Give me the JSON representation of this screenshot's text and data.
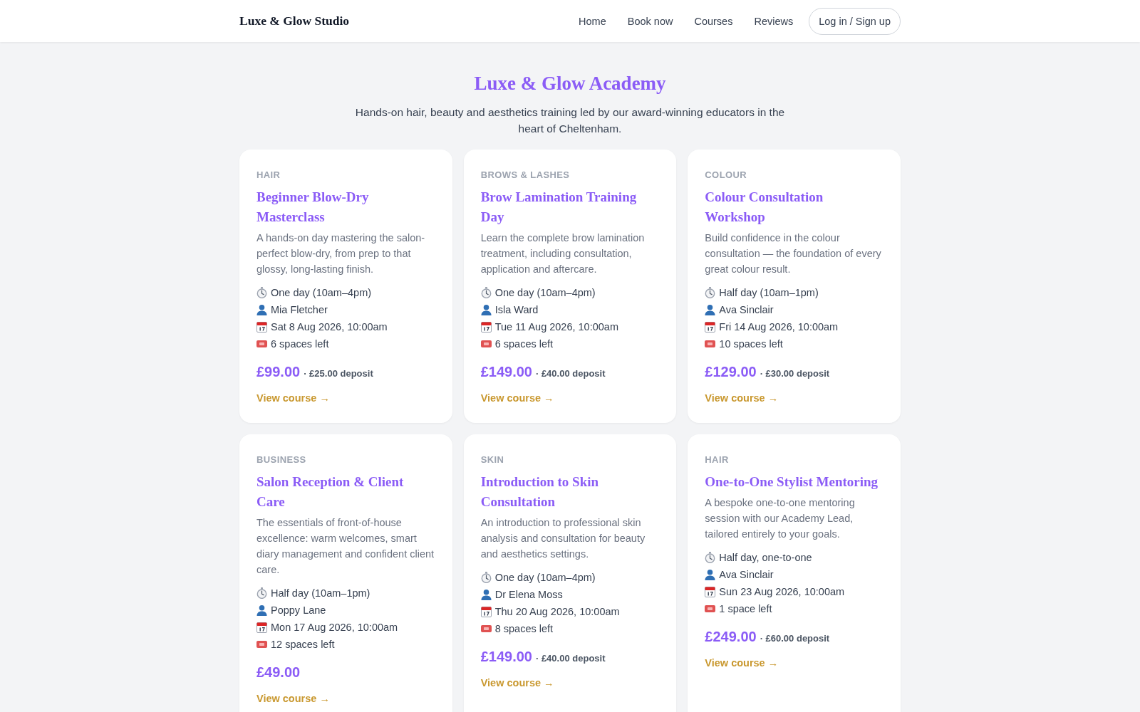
{
  "header": {
    "logo": "Luxe & Glow Studio",
    "nav": [
      "Home",
      "Book now",
      "Courses",
      "Reviews"
    ],
    "login_button": "Log in / Sign up"
  },
  "hero": {
    "title": "Luxe & Glow Academy",
    "subtitle": "Hands-on hair, beauty and aesthetics training led by our award-winning educators in the heart of Cheltenham."
  },
  "courses": [
    {
      "category": "HAIR",
      "title": "Beginner Blow-Dry Masterclass",
      "description": "A hands-on day mastering the salon-perfect blow-dry, from prep to that glossy, long-lasting finish.",
      "details": [
        {
          "kind": "duration",
          "text": "One day (10am–4pm)"
        },
        {
          "kind": "educator",
          "text": "Mia Fletcher"
        },
        {
          "kind": "date",
          "text": "Sat 8 Aug 2026, 10:00am"
        },
        {
          "kind": "spaces",
          "text": "6 spaces left"
        }
      ],
      "price": "£99.00",
      "deposit": "· £25.00 deposit",
      "link": "View course →"
    },
    {
      "category": "BROWS & LASHES",
      "title": "Brow Lamination Training Day",
      "description": "Learn the complete brow lamination treatment, including consultation, application and aftercare.",
      "details": [
        {
          "kind": "duration",
          "text": "One day (10am–4pm)"
        },
        {
          "kind": "educator",
          "text": "Isla Ward"
        },
        {
          "kind": "date",
          "text": "Tue 11 Aug 2026, 10:00am"
        },
        {
          "kind": "spaces",
          "text": "6 spaces left"
        }
      ],
      "price": "£149.00",
      "deposit": "· £40.00 deposit",
      "link": "View course →"
    },
    {
      "category": "COLOUR",
      "title": "Colour Consultation Workshop",
      "description": "Build confidence in the colour consultation — the foundation of every great colour result.",
      "details": [
        {
          "kind": "duration",
          "text": "Half day (10am–1pm)"
        },
        {
          "kind": "educator",
          "text": "Ava Sinclair"
        },
        {
          "kind": "date",
          "text": "Fri 14 Aug 2026, 10:00am"
        },
        {
          "kind": "spaces",
          "text": "10 spaces left"
        }
      ],
      "price": "£129.00",
      "deposit": "· £30.00 deposit",
      "link": "View course →"
    },
    {
      "category": "BUSINESS",
      "title": "Salon Reception & Client Care",
      "description": "The essentials of front-of-house excellence: warm welcomes, smart diary management and confident client care.",
      "details": [
        {
          "kind": "duration",
          "text": "Half day (10am–1pm)"
        },
        {
          "kind": "educator",
          "text": "Poppy Lane"
        },
        {
          "kind": "date",
          "text": "Mon 17 Aug 2026, 10:00am"
        },
        {
          "kind": "spaces",
          "text": "12 spaces left"
        }
      ],
      "price": "£49.00",
      "link": "View course →"
    },
    {
      "category": "SKIN",
      "title": "Introduction to Skin Consultation",
      "description": "An introduction to professional skin analysis and consultation for beauty and aesthetics settings.",
      "details": [
        {
          "kind": "duration",
          "text": "One day (10am–4pm)"
        },
        {
          "kind": "educator",
          "text": "Dr Elena Moss"
        },
        {
          "kind": "date",
          "text": "Thu 20 Aug 2026, 10:00am"
        },
        {
          "kind": "spaces",
          "text": "8 spaces left"
        }
      ],
      "price": "£149.00",
      "deposit": "· £40.00 deposit",
      "link": "View course →"
    },
    {
      "category": "HAIR",
      "title": "One-to-One Stylist Mentoring",
      "description": "A bespoke one-to-one mentoring session with our Academy Lead, tailored entirely to your goals.",
      "details": [
        {
          "kind": "duration",
          "text": "Half day, one-to-one"
        },
        {
          "kind": "educator",
          "text": "Ava Sinclair"
        },
        {
          "kind": "date",
          "text": "Sun 23 Aug 2026, 10:00am"
        },
        {
          "kind": "spaces",
          "text": "1 space left"
        }
      ],
      "price": "£249.00",
      "deposit": "· £60.00 deposit",
      "link": "View course →"
    }
  ]
}
